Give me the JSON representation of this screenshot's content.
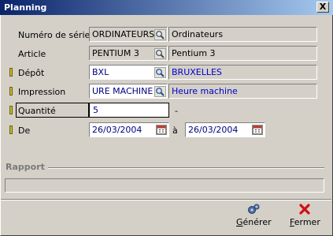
{
  "window": {
    "title": "Planning",
    "close_label": "X"
  },
  "fields": {
    "serie": {
      "label": "Numéro de série",
      "code": "ORDINATEURS",
      "desc": "Ordinateurs"
    },
    "article": {
      "label": "Article",
      "code": "PENTIUM 3",
      "desc": "Pentium 3"
    },
    "depot": {
      "label": "Dépôt",
      "code": "BXL",
      "desc": "BRUXELLES"
    },
    "impression": {
      "label": "Impression",
      "code": "URE MACHINE",
      "desc": "Heure machine"
    },
    "quantite": {
      "label": "Quantité",
      "value": "5",
      "suffix": "-"
    },
    "de": {
      "label": "De",
      "from": "26/03/2004",
      "to_label": "à",
      "to": "26/03/2004"
    }
  },
  "rapport": {
    "label": "Rapport"
  },
  "toolbar": {
    "generer": {
      "label_first": "G",
      "label_rest": "énérer"
    },
    "fermer": {
      "label_first": "F",
      "label_rest": "ermer"
    }
  },
  "colors": {
    "title_gradient_start": "#0a246a",
    "title_gradient_end": "#a6caf0",
    "value_blue": "#000080",
    "desc_blue": "#0000cc",
    "required_marker": "#c8b840"
  },
  "icons": [
    "lookup-icon",
    "calendar-icon",
    "generate-gears-icon",
    "close-x-icon"
  ]
}
